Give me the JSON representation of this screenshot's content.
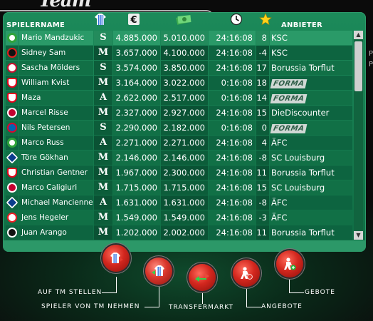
{
  "logo_text": "Team",
  "header": {
    "name_label": "SPIELERNAME",
    "seller_label": "ANBIETER",
    "icons": [
      "jersey-icon",
      "euro-icon",
      "money-icon",
      "clock-icon",
      "star-icon"
    ]
  },
  "players": [
    {
      "club": "wolfsburg",
      "name": "Mario Mandzukic",
      "pos": "S",
      "value": "4.885.000",
      "price": "5.010.000",
      "time": "24:16:08",
      "stars": "8",
      "seller": "KSC",
      "formasign": false
    },
    {
      "club": "leverkusen",
      "name": "Sidney Sam",
      "pos": "M",
      "value": "3.657.000",
      "price": "4.100.000",
      "time": "24:16:08",
      "stars": "-4",
      "seller": "KSC",
      "formasign": false
    },
    {
      "club": "augsburg",
      "name": "Sascha Mölders",
      "pos": "S",
      "value": "3.574.000",
      "price": "3.850.000",
      "time": "24:16:08",
      "stars": "17",
      "seller": "Borussia Torflut",
      "formasign": false
    },
    {
      "club": "stuttgart",
      "name": "William Kvist",
      "pos": "M",
      "value": "3.164.000",
      "price": "3.022.000",
      "time": "0:16:08",
      "stars": "18",
      "seller": "FORMA",
      "formasign": true
    },
    {
      "club": "stuttgart",
      "name": "Maza",
      "pos": "A",
      "value": "2.622.000",
      "price": "2.517.000",
      "time": "0:16:08",
      "stars": "14",
      "seller": "FORMA",
      "formasign": true
    },
    {
      "club": "mainz",
      "name": "Marcel Risse",
      "pos": "M",
      "value": "2.327.000",
      "price": "2.927.000",
      "time": "24:16:08",
      "stars": "15",
      "seller": "DieDiscounter",
      "formasign": false
    },
    {
      "club": "bayern",
      "name": "Nils Petersen",
      "pos": "S",
      "value": "2.290.000",
      "price": "2.182.000",
      "time": "0:16:08",
      "stars": "0",
      "seller": "FORMA",
      "formasign": true
    },
    {
      "club": "wolfsburg",
      "name": "Marco Russ",
      "pos": "A",
      "value": "2.271.000",
      "price": "2.271.000",
      "time": "24:16:08",
      "stars": "4",
      "seller": "ÄFC",
      "formasign": false
    },
    {
      "club": "hamburg",
      "name": "Töre Gökhan",
      "pos": "M",
      "value": "2.146.000",
      "price": "2.146.000",
      "time": "24:16:08",
      "stars": "-8",
      "seller": "SC Louisburg",
      "formasign": false
    },
    {
      "club": "stuttgart",
      "name": "Christian Gentner",
      "pos": "M",
      "value": "1.967.000",
      "price": "2.300.000",
      "time": "24:16:08",
      "stars": "11",
      "seller": "Borussia Torflut",
      "formasign": false
    },
    {
      "club": "mainz",
      "name": "Marco Caligiuri",
      "pos": "M",
      "value": "1.715.000",
      "price": "1.715.000",
      "time": "24:16:08",
      "stars": "15",
      "seller": "SC Louisburg",
      "formasign": false
    },
    {
      "club": "hamburg",
      "name": "Michael Mancienne",
      "pos": "A",
      "value": "1.631.000",
      "price": "1.631.000",
      "time": "24:16:08",
      "stars": "-8",
      "seller": "ÄFC",
      "formasign": false
    },
    {
      "club": "koeln",
      "name": "Jens Hegeler",
      "pos": "M",
      "value": "1.549.000",
      "price": "1.549.000",
      "time": "24:16:08",
      "stars": "-3",
      "seller": "ÄFC",
      "formasign": false
    },
    {
      "club": "gladbach",
      "name": "Juan Arango",
      "pos": "M",
      "value": "1.202.000",
      "price": "2.002.000",
      "time": "24:16:08",
      "stars": "11",
      "seller": "Borussia Torflut",
      "formasign": false
    }
  ],
  "actions": {
    "auf_tm": "AUF TM STELLEN",
    "spieler_von_tm": "SPIELER VON TM NEHMEN",
    "transfermarkt": "TRANSFERMARKT",
    "angebote": "ANGEBOTE",
    "gebote": "GEBOTE"
  },
  "colors": {
    "panel_green": "#117046",
    "accent_red": "#d3271e",
    "text_white": "#ffffff"
  }
}
